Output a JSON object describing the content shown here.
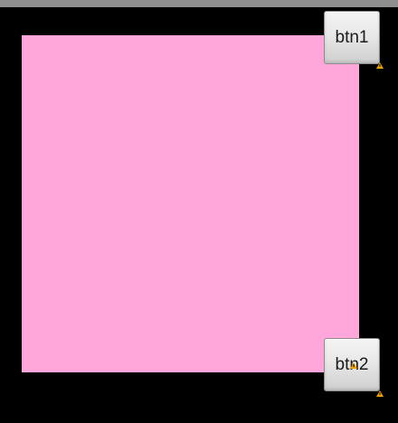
{
  "buttons": {
    "btn1_label": "btn1",
    "btn2_label": "btn2"
  },
  "colors": {
    "status_bar": "#8f8f8f",
    "background": "#000000",
    "panel": "#ffa6da",
    "warning": "#f0a000"
  },
  "icons": {
    "warning": "warning-triangle-icon"
  }
}
